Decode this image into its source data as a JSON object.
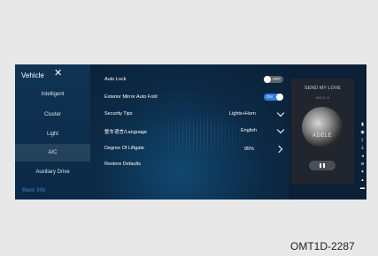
{
  "nav": {
    "title": "Vehicle",
    "items": [
      {
        "label": "Intelligent"
      },
      {
        "label": "Cluster"
      },
      {
        "label": "Light"
      },
      {
        "label": "A/C"
      },
      {
        "label": "Auxiliary Drive"
      },
      {
        "label": "Basic Info"
      }
    ]
  },
  "settings": {
    "auto_lock": {
      "label": "Auto Lock",
      "toggle": "OFF"
    },
    "mirror_fold": {
      "label": "Exterior Mirror Auto Fold",
      "toggle": "ON"
    },
    "security_tips": {
      "label": "Security Tips",
      "value": "Lights+Horn"
    },
    "language": {
      "label": "整车语言/Language",
      "value": "English"
    },
    "liftgate": {
      "label": "Degree Of Liftgate",
      "value": "95%"
    },
    "restore": {
      "label": "Restore Defaults"
    }
  },
  "player": {
    "song": "SEND MY LOVE",
    "artist": "ADELE 21",
    "album_text": "ADELE"
  },
  "colors": {
    "accent": "#3d88cc",
    "toggle_on": "#2f7de0",
    "toggle_off": "#5a626c"
  },
  "status_icons": [
    "signal-icon",
    "camera-icon",
    "bluetooth-icon",
    "usb-icon",
    "volume-icon",
    "wifi-icon",
    "seat-icon",
    "user-icon",
    "battery-icon"
  ],
  "caption": "OMT1D-2287"
}
